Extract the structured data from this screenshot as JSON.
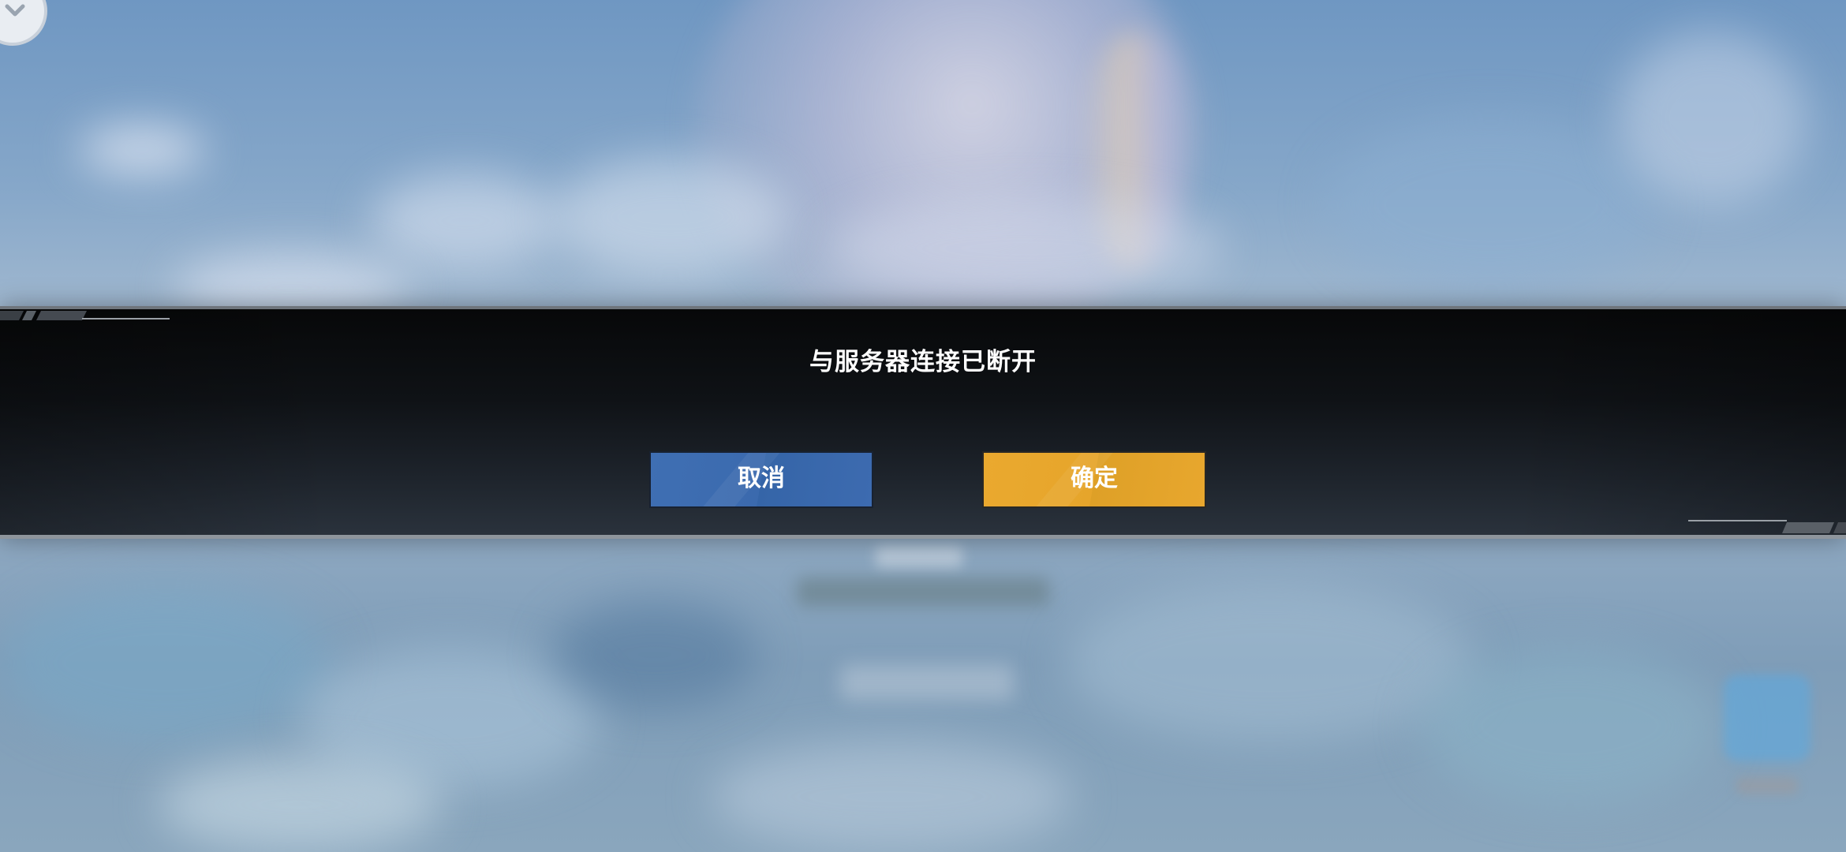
{
  "dialog": {
    "message": "与服务器连接已断开",
    "cancel_label": "取消",
    "confirm_label": "确定"
  },
  "colors": {
    "cancel_button": "#3d6bb0",
    "confirm_button": "#e8a72e",
    "dialog_background": "#14181d",
    "text": "#ffffff"
  },
  "icons": {
    "corner": "chevron-down-icon"
  }
}
